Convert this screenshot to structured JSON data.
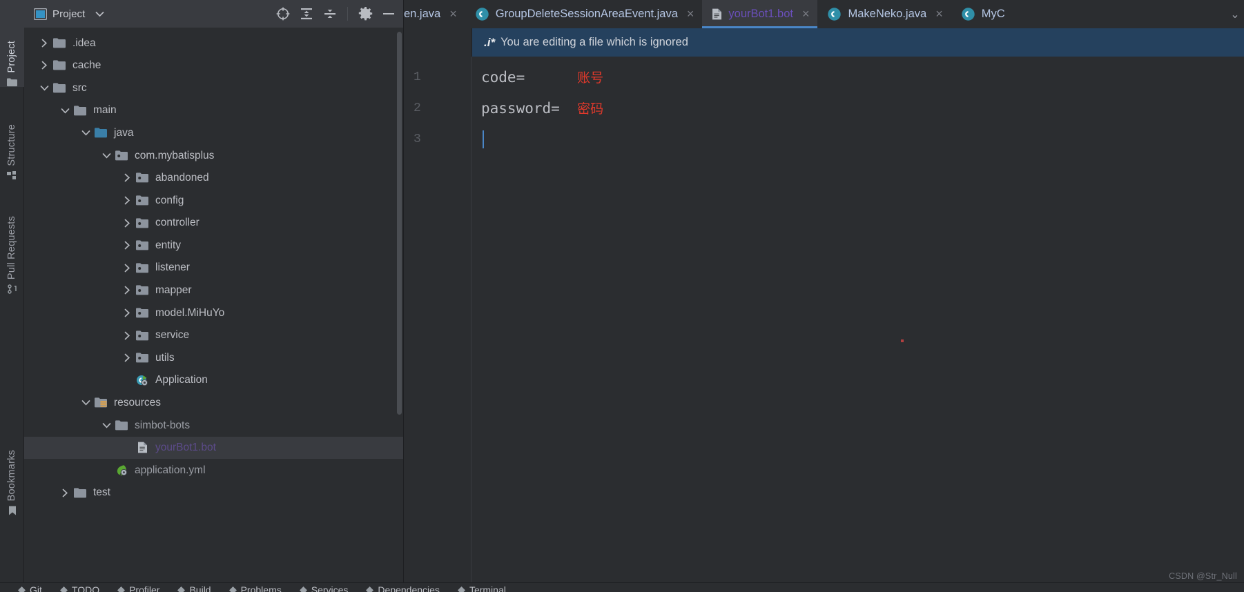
{
  "tool_window_tabs": [
    {
      "label": "Project",
      "icon": "folder-icon",
      "active": true
    },
    {
      "label": "Structure",
      "icon": "structure-icon",
      "active": false
    },
    {
      "label": "Pull Requests",
      "icon": "pull-request-icon",
      "active": false
    },
    {
      "label": "Bookmarks",
      "icon": "bookmark-icon",
      "active": false
    }
  ],
  "project_panel": {
    "title": "Project",
    "dropdown_icon": "chevron-down-icon",
    "toolbar_icons": [
      "select-opened-file-icon",
      "expand-all-icon",
      "collapse-all-icon",
      "gear-icon",
      "hide-icon"
    ],
    "tree": [
      {
        "label": ".idea",
        "depth": 1,
        "arrow": "collapsed",
        "icon": "folder-icon"
      },
      {
        "label": "cache",
        "depth": 1,
        "arrow": "collapsed",
        "icon": "folder-icon"
      },
      {
        "label": "src",
        "depth": 1,
        "arrow": "expanded",
        "icon": "folder-icon"
      },
      {
        "label": "main",
        "depth": 2,
        "arrow": "expanded",
        "icon": "folder-icon"
      },
      {
        "label": "java",
        "depth": 3,
        "arrow": "expanded",
        "icon": "source-root-icon"
      },
      {
        "label": "com.mybatisplus",
        "depth": 4,
        "arrow": "expanded",
        "icon": "package-icon"
      },
      {
        "label": "abandoned",
        "depth": 5,
        "arrow": "collapsed",
        "icon": "package-icon"
      },
      {
        "label": "config",
        "depth": 5,
        "arrow": "collapsed",
        "icon": "package-icon"
      },
      {
        "label": "controller",
        "depth": 5,
        "arrow": "collapsed",
        "icon": "package-icon"
      },
      {
        "label": "entity",
        "depth": 5,
        "arrow": "collapsed",
        "icon": "package-icon"
      },
      {
        "label": "listener",
        "depth": 5,
        "arrow": "collapsed",
        "icon": "package-icon"
      },
      {
        "label": "mapper",
        "depth": 5,
        "arrow": "collapsed",
        "icon": "package-icon"
      },
      {
        "label": "model.MiHuYo",
        "depth": 5,
        "arrow": "collapsed",
        "icon": "package-icon"
      },
      {
        "label": "service",
        "depth": 5,
        "arrow": "collapsed",
        "icon": "package-icon"
      },
      {
        "label": "utils",
        "depth": 5,
        "arrow": "collapsed",
        "icon": "package-icon"
      },
      {
        "label": "Application",
        "depth": 5,
        "arrow": "none",
        "icon": "spring-class-run-icon"
      },
      {
        "label": "resources",
        "depth": 3,
        "arrow": "expanded",
        "icon": "resource-root-icon"
      },
      {
        "label": "simbot-bots",
        "depth": 4,
        "arrow": "expanded",
        "icon": "folder-icon"
      },
      {
        "label": "yourBot1.bot",
        "depth": 5,
        "arrow": "none",
        "icon": "file-text-icon",
        "selected": true,
        "ignored": true
      },
      {
        "label": "application.yml",
        "depth": 4,
        "arrow": "none",
        "icon": "spring-yaml-icon"
      },
      {
        "label": "test",
        "depth": 2,
        "arrow": "collapsed",
        "icon": "folder-icon"
      }
    ]
  },
  "editor": {
    "tabs": [
      {
        "label": "en.java",
        "icon": "none",
        "active": false,
        "clipped": true
      },
      {
        "label": "GroupDeleteSessionAreaEvent.java",
        "icon": "class-icon",
        "active": false
      },
      {
        "label": "yourBot1.bot",
        "icon": "file-text-icon",
        "active": true
      },
      {
        "label": "MakeNeko.java",
        "icon": "class-icon",
        "active": false
      },
      {
        "label": "MyC",
        "icon": "class-icon",
        "active": false,
        "clipped": true
      }
    ],
    "tab_close_glyph": "×",
    "tabs_overflow_glyph": "⌄",
    "banner": {
      "icon_text": ".i*",
      "message": "You are editing a file which is ignored"
    },
    "gutter_lines": [
      "1",
      "2",
      "3"
    ],
    "lines": [
      {
        "code": "code=",
        "gap": "      ",
        "comment": "账号"
      },
      {
        "code": "password=",
        "gap": "  ",
        "comment": "密码"
      },
      {
        "code": "",
        "gap": "",
        "comment": "",
        "caret": true
      }
    ]
  },
  "bottom_bar": {
    "items": [
      "Git",
      "TODO",
      "Profiler",
      "Build",
      "Problems",
      "Services",
      "Dependencies",
      "Terminal"
    ]
  },
  "watermark": "CSDN @Str_Null",
  "colors": {
    "background": "#2b2d30",
    "panel_header": "#393b40",
    "selection": "#393b40",
    "banner_bg": "#25415e",
    "tab_text": "#b5c6e4",
    "active_tab_text": "#6a4fbb",
    "ignored_file": "#5c4b8a",
    "accent_underline": "#4a86c7",
    "comment_red": "#e0392b",
    "caret": "#4a86c7"
  }
}
